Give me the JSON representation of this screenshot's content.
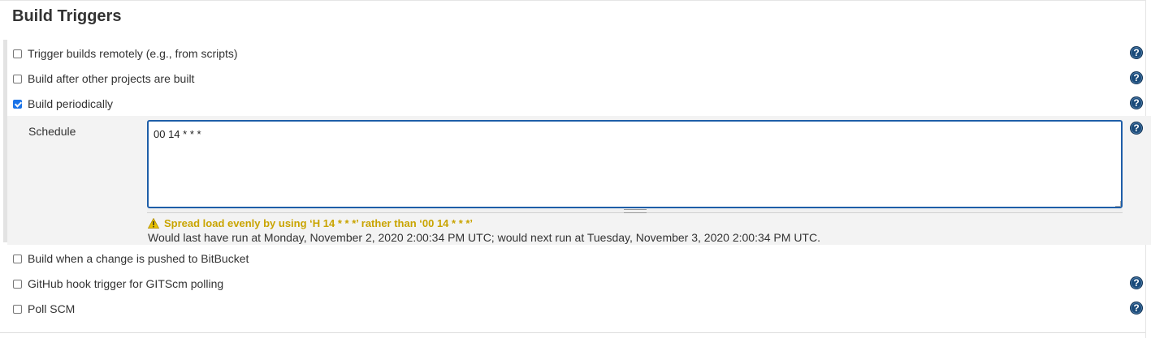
{
  "section": {
    "title": "Build Triggers"
  },
  "triggers": [
    {
      "label": "Trigger builds remotely (e.g., from scripts)",
      "checked": false
    },
    {
      "label": "Build after other projects are built",
      "checked": false
    },
    {
      "label": "Build periodically",
      "checked": true
    },
    {
      "label": "Build when a change is pushed to BitBucket",
      "checked": false
    },
    {
      "label": "GitHub hook trigger for GITScm polling",
      "checked": false
    },
    {
      "label": "Poll SCM",
      "checked": false
    }
  ],
  "schedule": {
    "label": "Schedule",
    "value": "00 14 * * *",
    "warning": "Spread load evenly by using ‘H 14 * * *’ rather than ‘00 14 * * *’",
    "info": "Would last have run at Monday, November 2, 2020 2:00:34 PM UTC; would next run at Tuesday, November 3, 2020 2:00:34 PM UTC."
  },
  "help": {
    "glyph": "?"
  },
  "colors": {
    "accent": "#1e5ea8",
    "warning": "#c9a400",
    "help_icon": "#1b4b7a"
  }
}
